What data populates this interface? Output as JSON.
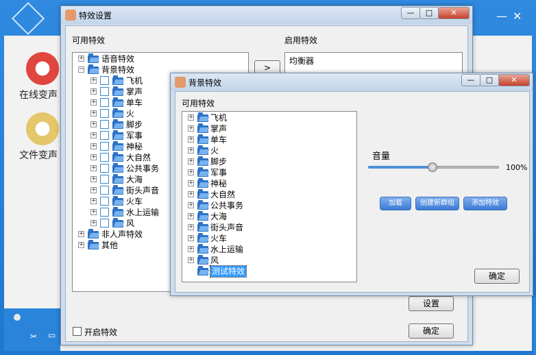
{
  "background_app": {
    "features": [
      {
        "label": "在线变声",
        "icon": "lips-icon"
      },
      {
        "label": "文件变声",
        "icon": "file-icon"
      }
    ],
    "close_glyph": "✕",
    "minimize_glyph": "—"
  },
  "main_window": {
    "title": "特效设置",
    "available_label": "可用特效",
    "enabled_label": "启用特效",
    "enabled_items": [
      "均衡器"
    ],
    "enable_checkbox_label": "开启特效",
    "enable_checked": false,
    "settings_button": "设置",
    "ok_button": "确定",
    "tree": [
      {
        "label": "语音特效",
        "level": 0,
        "expand": "+"
      },
      {
        "label": "背景特效",
        "level": 0,
        "expand": "−"
      },
      {
        "label": "飞机",
        "level": 1,
        "expand": "+"
      },
      {
        "label": "掌声",
        "level": 1,
        "expand": "+"
      },
      {
        "label": "单车",
        "level": 1,
        "expand": "+"
      },
      {
        "label": "火",
        "level": 1,
        "expand": "+"
      },
      {
        "label": "脚步",
        "level": 1,
        "expand": "+"
      },
      {
        "label": "军事",
        "level": 1,
        "expand": "+"
      },
      {
        "label": "神秘",
        "level": 1,
        "expand": "+"
      },
      {
        "label": "大自然",
        "level": 1,
        "expand": "+"
      },
      {
        "label": "公共事务",
        "level": 1,
        "expand": "+"
      },
      {
        "label": "大海",
        "level": 1,
        "expand": "+"
      },
      {
        "label": "街头声音",
        "level": 1,
        "expand": "+"
      },
      {
        "label": "火车",
        "level": 1,
        "expand": "+"
      },
      {
        "label": "水上运输",
        "level": 1,
        "expand": "+"
      },
      {
        "label": "风",
        "level": 1,
        "expand": "+"
      },
      {
        "label": "非人声特效",
        "level": 0,
        "expand": "+"
      },
      {
        "label": "其他",
        "level": 0,
        "expand": "+"
      }
    ]
  },
  "bg_dialog": {
    "title": "背景特效",
    "available_label": "可用特效",
    "volume_label": "音量",
    "volume_value": "100%",
    "volume_fraction": 0.49,
    "load_button": "加载",
    "new_group_button": "创建新群组",
    "add_effect_button": "添加特效",
    "ok_button": "确定",
    "tree": [
      {
        "label": "飞机",
        "expand": "+"
      },
      {
        "label": "掌声",
        "expand": "+"
      },
      {
        "label": "单车",
        "expand": "+"
      },
      {
        "label": "火",
        "expand": "+"
      },
      {
        "label": "脚步",
        "expand": "+"
      },
      {
        "label": "军事",
        "expand": "+"
      },
      {
        "label": "神秘",
        "expand": "+"
      },
      {
        "label": "大自然",
        "expand": "+"
      },
      {
        "label": "公共事务",
        "expand": "+"
      },
      {
        "label": "大海",
        "expand": "+"
      },
      {
        "label": "街头声音",
        "expand": "+"
      },
      {
        "label": "火车",
        "expand": "+"
      },
      {
        "label": "水上运输",
        "expand": "+"
      },
      {
        "label": "风",
        "expand": "+"
      },
      {
        "label": "测试特效",
        "expand": "",
        "selected": true
      }
    ]
  },
  "caption_buttons": {
    "minimize": "—",
    "maximize": "□",
    "close": "✕"
  }
}
